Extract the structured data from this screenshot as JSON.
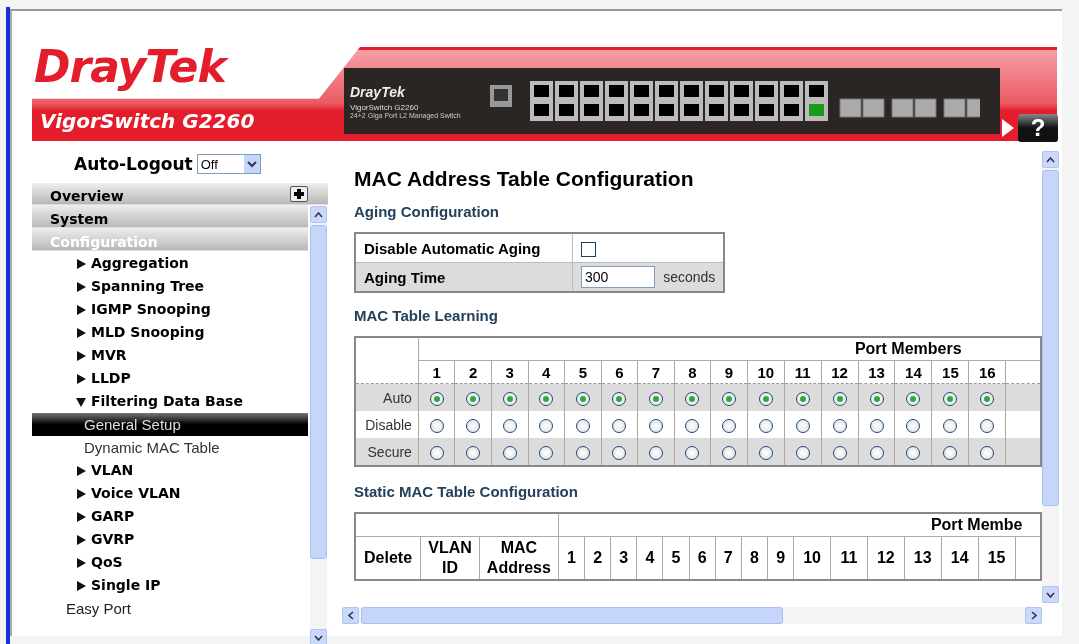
{
  "header": {
    "brand": "DrayTek",
    "product": "VigorSwitch G2260",
    "device": {
      "brand": "DrayTek",
      "model": "VigorSwitch G2260",
      "description": "24+2 Giga Port L2 Managed Switch"
    },
    "help": "?"
  },
  "sidebar": {
    "auto_logout": {
      "label": "Auto-Logout",
      "value": "Off"
    },
    "sections": [
      {
        "label": "Overview",
        "selected": false,
        "expandable": true
      },
      {
        "label": "System",
        "selected": false,
        "expandable": false
      },
      {
        "label": "Configuration",
        "selected": true,
        "expandable": false
      }
    ],
    "items": [
      {
        "label": "Aggregation",
        "kind": "group",
        "expanded": false
      },
      {
        "label": "Spanning Tree",
        "kind": "group",
        "expanded": false
      },
      {
        "label": "IGMP Snooping",
        "kind": "group",
        "expanded": false
      },
      {
        "label": "MLD Snooping",
        "kind": "group",
        "expanded": false
      },
      {
        "label": "MVR",
        "kind": "group",
        "expanded": false
      },
      {
        "label": "LLDP",
        "kind": "group",
        "expanded": false
      },
      {
        "label": "Filtering Data Base",
        "kind": "group",
        "expanded": true,
        "children": [
          {
            "label": "General Setup",
            "selected": true
          },
          {
            "label": "Dynamic MAC Table",
            "selected": false
          }
        ]
      },
      {
        "label": "VLAN",
        "kind": "group",
        "expanded": false
      },
      {
        "label": "Voice VLAN",
        "kind": "group",
        "expanded": false
      },
      {
        "label": "GARP",
        "kind": "group",
        "expanded": false
      },
      {
        "label": "GVRP",
        "kind": "group",
        "expanded": false
      },
      {
        "label": "QoS",
        "kind": "group",
        "expanded": false
      },
      {
        "label": "Single IP",
        "kind": "group",
        "expanded": false
      },
      {
        "label": "Easy Port",
        "kind": "link"
      }
    ]
  },
  "main": {
    "title": "MAC Address Table Configuration",
    "aging": {
      "heading": "Aging Configuration",
      "disable_label": "Disable Automatic Aging",
      "disable_checked": false,
      "time_label": "Aging Time",
      "time_value": "300",
      "unit": "seconds"
    },
    "learning": {
      "heading": "MAC Table Learning",
      "group_header": "Port Members",
      "ports": [
        "1",
        "2",
        "3",
        "4",
        "5",
        "6",
        "7",
        "8",
        "9",
        "10",
        "11",
        "12",
        "13",
        "14",
        "15",
        "16"
      ],
      "rows": [
        {
          "label": "Auto",
          "cells": [
            {
              "selected": true
            },
            {
              "selected": true
            },
            {
              "selected": true
            },
            {
              "selected": true
            },
            {
              "selected": true
            },
            {
              "selected": true
            },
            {
              "selected": true
            },
            {
              "selected": true
            },
            {
              "selected": true
            },
            {
              "selected": true
            },
            {
              "selected": true
            },
            {
              "selected": true
            },
            {
              "selected": true
            },
            {
              "selected": true
            },
            {
              "selected": true
            },
            {
              "selected": true
            }
          ]
        },
        {
          "label": "Disable",
          "cells": [
            {
              "selected": false
            },
            {
              "selected": false
            },
            {
              "selected": false
            },
            {
              "selected": false
            },
            {
              "selected": false
            },
            {
              "selected": false
            },
            {
              "selected": false
            },
            {
              "selected": false
            },
            {
              "selected": false
            },
            {
              "selected": false
            },
            {
              "selected": false
            },
            {
              "selected": false
            },
            {
              "selected": false
            },
            {
              "selected": false
            },
            {
              "selected": false
            },
            {
              "selected": false
            }
          ]
        },
        {
          "label": "Secure",
          "cells": [
            {
              "selected": false
            },
            {
              "selected": false
            },
            {
              "selected": false
            },
            {
              "selected": false
            },
            {
              "selected": false
            },
            {
              "selected": false
            },
            {
              "selected": false
            },
            {
              "selected": false
            },
            {
              "selected": false
            },
            {
              "selected": false
            },
            {
              "selected": false
            },
            {
              "selected": false
            },
            {
              "selected": false
            },
            {
              "selected": false
            },
            {
              "selected": false
            },
            {
              "selected": false
            }
          ]
        }
      ]
    },
    "static": {
      "heading": "Static MAC Table Configuration",
      "group_header": "Port Membe",
      "columns": [
        "Delete",
        "VLAN ID",
        "MAC Address"
      ],
      "ports": [
        "1",
        "2",
        "3",
        "4",
        "5",
        "6",
        "7",
        "8",
        "9",
        "10",
        "11",
        "12",
        "13",
        "14",
        "15"
      ]
    }
  }
}
